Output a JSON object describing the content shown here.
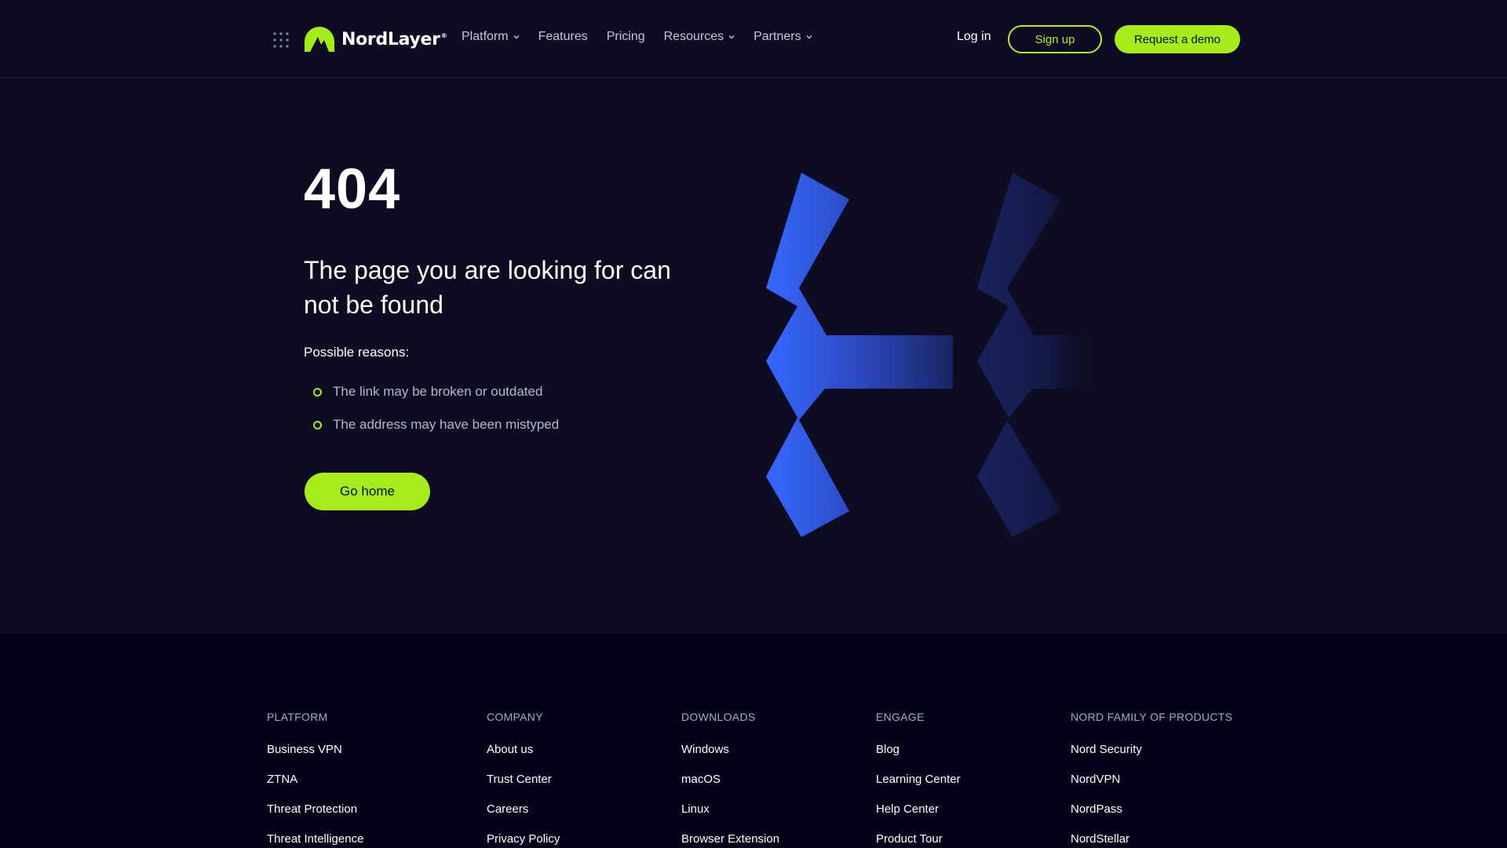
{
  "colors": {
    "accent": "#a6eb1a",
    "background": "#0d0c22",
    "footer_bg": "#030218",
    "graphic_blue": "#3366ff"
  },
  "header": {
    "menu_icon": "grid-menu-icon",
    "logo_text": "NordLayer",
    "logo_mark": "®",
    "nav": [
      {
        "label": "Platform",
        "dropdown": true
      },
      {
        "label": "Features",
        "dropdown": false
      },
      {
        "label": "Pricing",
        "dropdown": false
      },
      {
        "label": "Resources",
        "dropdown": true
      },
      {
        "label": "Partners",
        "dropdown": true
      }
    ],
    "login_label": "Log in",
    "signup_label": "Sign up",
    "demo_label": "Request a demo"
  },
  "main": {
    "code": "404",
    "title": "The page you are looking for can not be found",
    "reasons_label": "Possible reasons:",
    "reasons": [
      "The link may be broken or outdated",
      "The address may have been mistyped"
    ],
    "go_home_label": "Go home"
  },
  "footer": {
    "columns": [
      {
        "heading": "PLATFORM",
        "links": [
          "Business VPN",
          "ZTNA",
          "Threat Protection",
          "Threat Intelligence"
        ]
      },
      {
        "heading": "COMPANY",
        "links": [
          "About us",
          "Trust Center",
          "Careers",
          "Privacy Policy"
        ]
      },
      {
        "heading": "DOWNLOADS",
        "links": [
          "Windows",
          "macOS",
          "Linux",
          "Browser Extension"
        ]
      },
      {
        "heading": "ENGAGE",
        "links": [
          "Blog",
          "Learning Center",
          "Help Center",
          "Product Tour"
        ]
      },
      {
        "heading": "NORD FAMILY OF PRODUCTS",
        "links": [
          "Nord Security",
          "NordVPN",
          "NordPass",
          "NordStellar"
        ]
      }
    ]
  }
}
